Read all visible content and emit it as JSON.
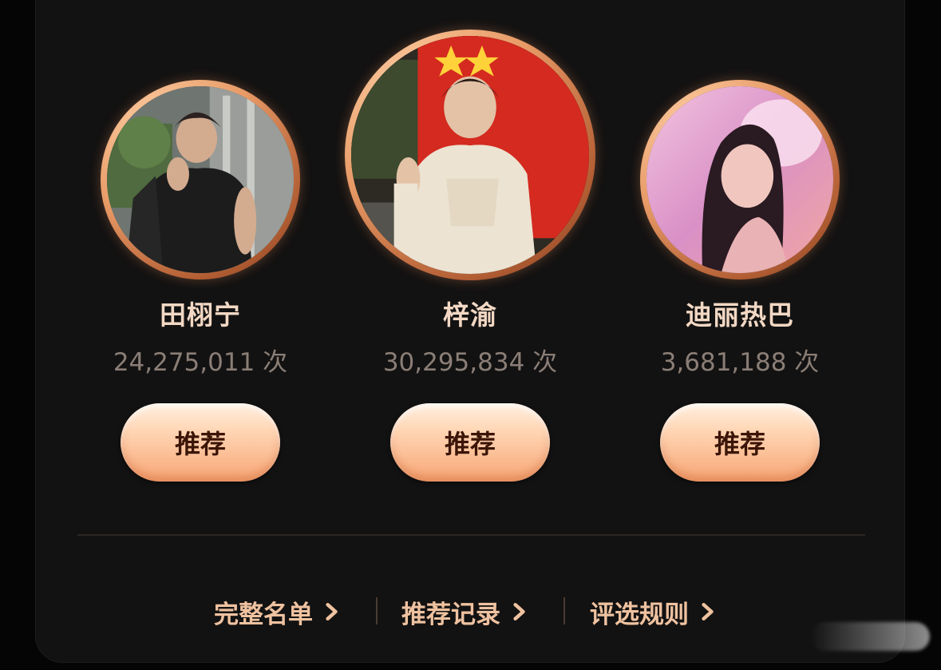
{
  "nominees": [
    {
      "name": "田栩宁",
      "count": "24,275,011 次",
      "button_label": "推荐",
      "avatar": "avatar-photo-man-black-shirt"
    },
    {
      "name": "梓渝",
      "count": "30,295,834 次",
      "button_label": "推荐",
      "avatar": "avatar-photo-man-hoodie-flag"
    },
    {
      "name": "迪丽热巴",
      "count": "3,681,188 次",
      "button_label": "推荐",
      "avatar": "avatar-photo-woman-pink-light"
    }
  ],
  "footer": {
    "links": [
      {
        "label": "完整名单",
        "icon": "chevron-right-icon"
      },
      {
        "label": "推荐记录",
        "icon": "chevron-right-icon"
      },
      {
        "label": "评选规则",
        "icon": "chevron-right-icon"
      }
    ]
  },
  "colors": {
    "background": "#050505",
    "panel": "#131212",
    "name_text": "#f2d8c4",
    "count_text": "#8a7e76",
    "button_text": "#3b1507",
    "link_text": "#efc2a0",
    "ring_accent": "#e79a66"
  }
}
